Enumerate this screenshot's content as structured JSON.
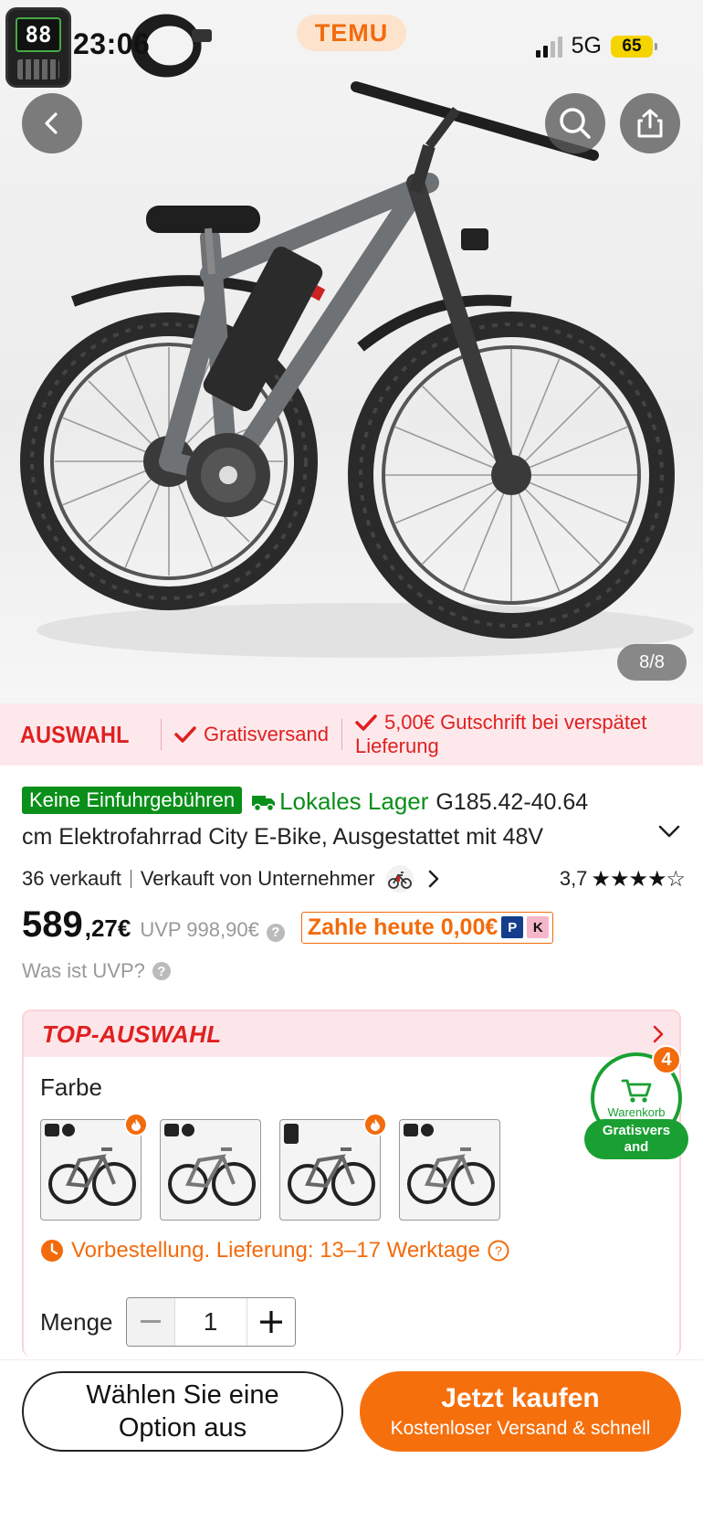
{
  "status_bar": {
    "time": "23:06",
    "network": "5G",
    "battery": "65"
  },
  "header": {
    "logo": "TEMU",
    "icons": [
      "back-icon",
      "search-icon",
      "share-icon"
    ]
  },
  "gallery": {
    "counter": "8/8"
  },
  "benefits": {
    "brand": "AUSWAHL",
    "shipping": "Gratisversand",
    "credit_line1": "5,00€ Gutschrift bei verspätet",
    "credit_line2": "Lieferung"
  },
  "product": {
    "badge": "Keine Einfuhrgebühren",
    "local_stock": "Lokales Lager",
    "title_line1": "G185.42-40.64",
    "title_line2": "cm Elektrofahrrad City E-Bike, Ausgestattet mit 48V",
    "sold": "36 verkauft",
    "seller": "Verkauft von Unternehmer",
    "rating": "3,7",
    "stars": "★★★★☆",
    "price_main": "589",
    "price_cents": ",27€",
    "uvp": "UVP 998,90€",
    "pay_today": "Zahle heute 0,00€",
    "uvp_question": "Was ist UVP?"
  },
  "selection": {
    "header": "TOP-AUSWAHL",
    "color_label": "Farbe",
    "swatch_count": 4,
    "preorder": "Vorbestellung. Lieferung: 13–17 Werktage",
    "quantity_label": "Menge",
    "quantity": "1"
  },
  "cart": {
    "label": "Warenkorb",
    "count": "4",
    "shipping_line1": "Gratisvers",
    "shipping_line2": "and"
  },
  "footer": {
    "option_line1": "Wählen Sie eine",
    "option_line2": "Option aus",
    "buy": "Jetzt kaufen",
    "buy_sub": "Kostenloser Versand & schnell"
  },
  "colors": {
    "accent_orange": "#f66f0d",
    "auswahl_red": "#e02020",
    "green": "#0a8f1a"
  }
}
